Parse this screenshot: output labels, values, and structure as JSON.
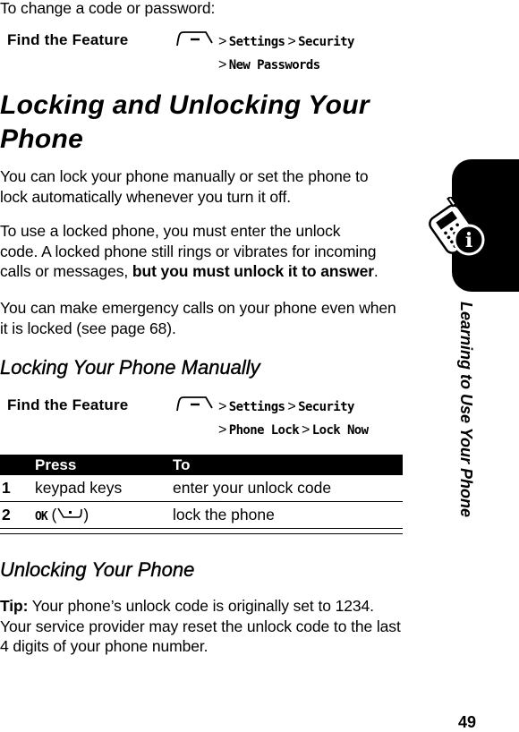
{
  "intro": "To change a code or password:",
  "find_feature_1": {
    "label": "Find the Feature",
    "menu_icon": "menu-key-icon",
    "path_line1": [
      "Settings",
      "Security"
    ],
    "path_line2": [
      "New Passwords"
    ],
    "separator": ">"
  },
  "section_title": "Locking and Unlocking Your Phone",
  "section_title_line1": "Locking and Unlocking Your",
  "section_title_line2": "Phone",
  "para1": "You can lock your phone manually or set the phone to lock automatically whenever you turn it off.",
  "para1_line1": "You can lock your phone manually or set the phone to",
  "para1_line2": "lock automatically whenever you turn it off.",
  "para2_line1": "To use a locked phone, you must enter the unlock",
  "para2_line2": "code. A locked phone still rings or vibrates for incoming",
  "para2_line3_prefix": "calls or messages, ",
  "para2_line3_bold": "but you must unlock it to answer",
  "para2_line3_suffix": ".",
  "para3_line1": "You can make emergency calls on your phone even when",
  "para3_line2": "it is locked (see page 68).",
  "subsection1_title": "Locking Your Phone Manually",
  "find_feature_2": {
    "label": "Find the Feature",
    "menu_icon": "menu-key-icon",
    "path_line1": [
      "Settings",
      "Security"
    ],
    "path_line2": [
      "Phone Lock",
      "Lock Now"
    ],
    "separator": ">"
  },
  "steps_table": {
    "headers": [
      "",
      "Press",
      "To"
    ],
    "rows": [
      {
        "num": "1",
        "press": "keypad keys",
        "to": "enter your unlock code"
      },
      {
        "num": "2",
        "press_key": "OK",
        "press_icon": "right-soft-key-icon",
        "to": "lock the phone"
      }
    ]
  },
  "subsection2_title": "Unlocking Your Phone",
  "tip": {
    "label": "Tip:",
    "line1": " Your phone’s unlock code is originally set to 1234.",
    "line2": "Your service provider may reset the unlock code to the last",
    "line3": "4 digits of your phone number."
  },
  "side_tab": {
    "icon": "phone-info-icon",
    "chapter_title": "Learning to Use Your Phone"
  },
  "page_number": "49"
}
